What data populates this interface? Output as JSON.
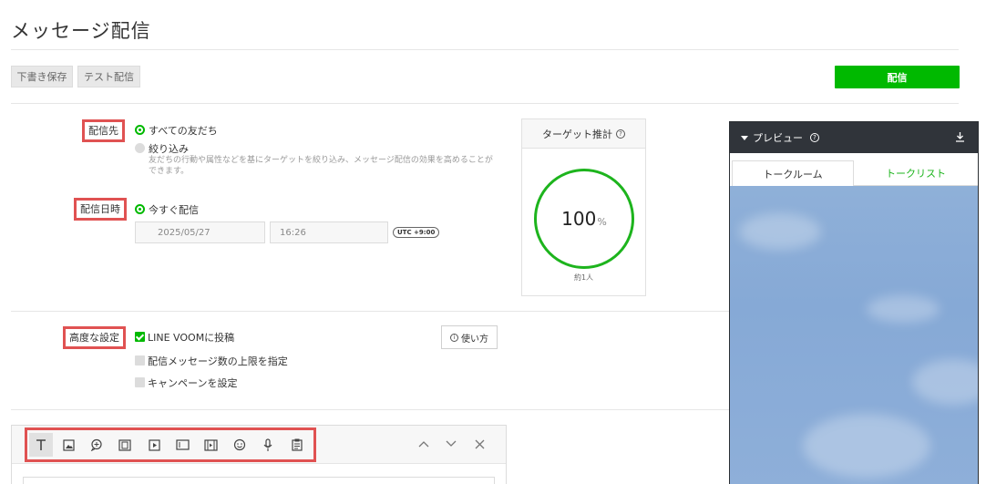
{
  "page": {
    "title": "メッセージ配信"
  },
  "toolbar": {
    "draft_label": "下書き保存",
    "test_label": "テスト配信",
    "send_label": "配信"
  },
  "recipients": {
    "label": "配信先",
    "options": [
      {
        "label": "すべての友だち",
        "selected": true
      },
      {
        "label": "絞り込み",
        "selected": false
      }
    ],
    "description": "友だちの行動や属性などを基にターゲットを絞り込み、メッセージ配信の効果を高めることができます。"
  },
  "schedule": {
    "label": "配信日時",
    "options": [
      {
        "label": "今すぐ配信",
        "selected": true
      }
    ],
    "date_value": "2025/05/27",
    "time_value": "16:26",
    "timezone": "UTC +9:00"
  },
  "target": {
    "title": "ターゲット推計",
    "percent": "100",
    "percent_unit": "%",
    "count": "約1人"
  },
  "advanced": {
    "label": "高度な設定",
    "options": [
      {
        "label": "LINE VOOMに投稿",
        "checked": true
      },
      {
        "label": "配信メッセージ数の上限を指定",
        "checked": false
      },
      {
        "label": "キャンペーンを設定",
        "checked": false
      }
    ],
    "howto_label": "使い方"
  },
  "editor": {
    "tools": [
      "text-icon",
      "image-icon",
      "bubble-icon",
      "card-icon",
      "video-icon",
      "rich-message-icon",
      "rich-video-icon",
      "sticker-icon",
      "voice-icon",
      "coupon-icon"
    ],
    "nav": [
      "chevron-up-icon",
      "chevron-down-icon",
      "close-icon"
    ]
  },
  "preview": {
    "title": "プレビュー",
    "tabs": [
      "トークルーム",
      "トークリスト"
    ],
    "active_tab": 0
  },
  "colors": {
    "accent": "#00b900",
    "highlight_border": "#e05252",
    "preview_header": "#30343a",
    "preview_bg": "#8fb0d8"
  }
}
